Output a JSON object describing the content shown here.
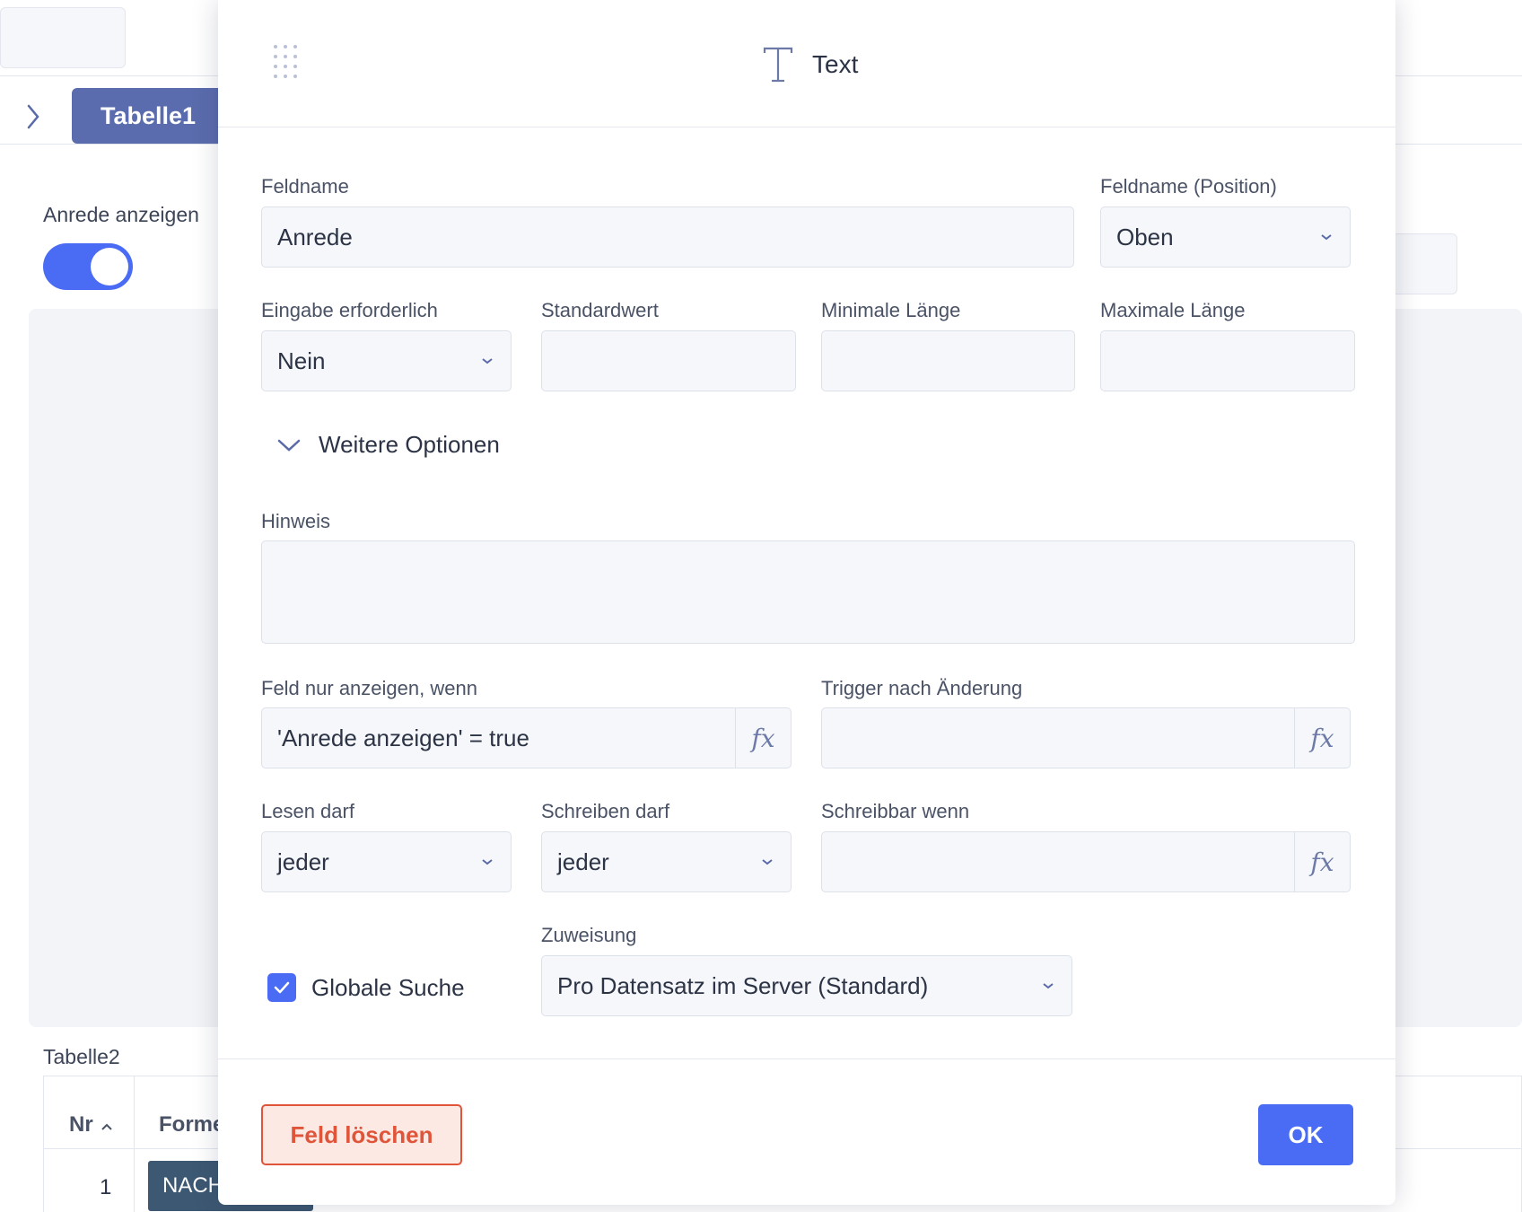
{
  "background": {
    "tab_label": "Tabelle1",
    "toggle_label": "Anrede anzeigen",
    "toggle_on": true,
    "table_label": "Tabelle2",
    "table_columns": [
      "Nr",
      "Forme"
    ],
    "table_rows": [
      {
        "nr": "1",
        "form": "NACH"
      }
    ]
  },
  "modal": {
    "title": "Text",
    "title_icon": "text-type-icon",
    "fields": {
      "feldname": {
        "label": "Feldname",
        "value": "Anrede"
      },
      "feldname_position": {
        "label": "Feldname (Position)",
        "value": "Oben"
      },
      "eingabe_erforderlich": {
        "label": "Eingabe erforderlich",
        "value": "Nein"
      },
      "standardwert": {
        "label": "Standardwert",
        "value": ""
      },
      "minimale_laenge": {
        "label": "Minimale Länge",
        "value": ""
      },
      "maximale_laenge": {
        "label": "Maximale Länge",
        "value": ""
      },
      "hinweis": {
        "label": "Hinweis",
        "value": ""
      },
      "feld_nur_anzeigen": {
        "label": "Feld nur anzeigen, wenn",
        "value": "'Anrede anzeigen' = true"
      },
      "trigger": {
        "label": "Trigger nach Änderung",
        "value": ""
      },
      "lesen_darf": {
        "label": "Lesen darf",
        "value": "jeder"
      },
      "schreiben_darf": {
        "label": "Schreiben darf",
        "value": "jeder"
      },
      "schreibbar_wenn": {
        "label": "Schreibbar wenn",
        "value": ""
      },
      "zuweisung": {
        "label": "Zuweisung",
        "value": "Pro Datensatz im Server (Standard)"
      }
    },
    "more_options_label": "Weitere Optionen",
    "fx_label": "fx",
    "global_search": {
      "label": "Globale Suche",
      "checked": true
    },
    "delete_button": "Feld löschen",
    "ok_button": "OK"
  },
  "colors": {
    "accent": "#4a6cf5",
    "tab": "#5b6cae",
    "danger": "#e0553a",
    "danger_bg": "#fde9e4"
  }
}
